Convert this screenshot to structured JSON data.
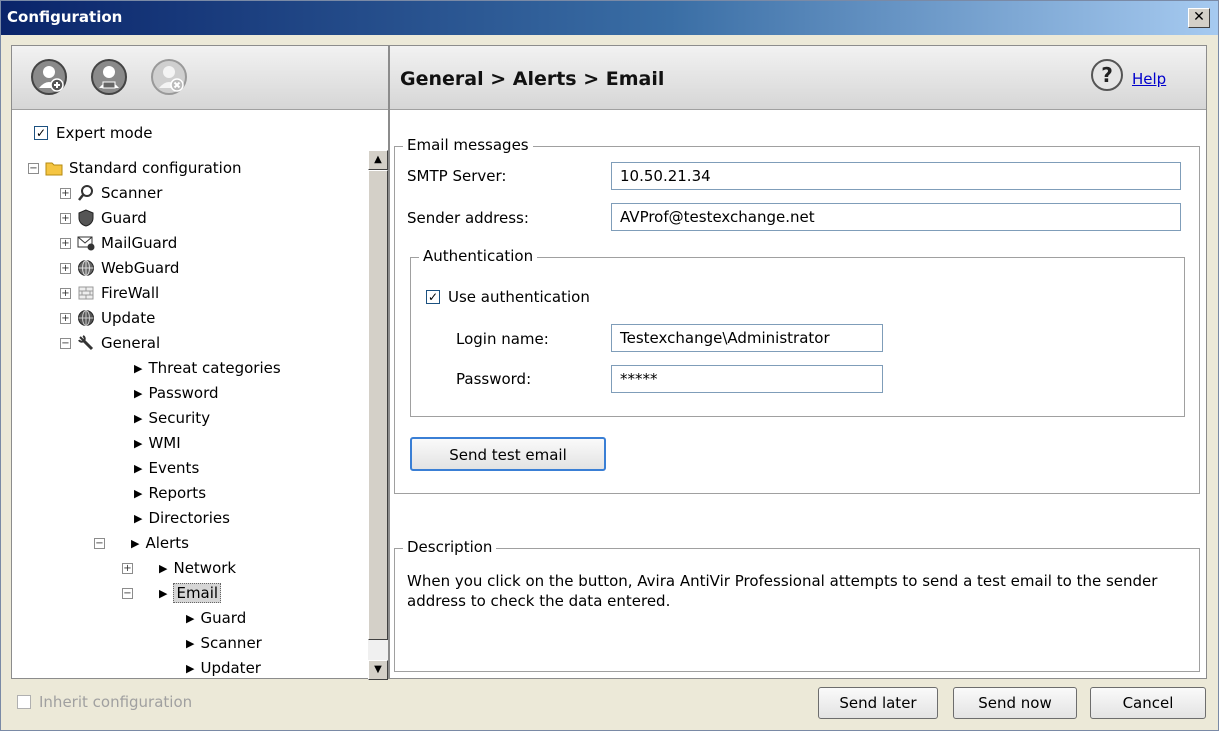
{
  "window": {
    "title": "Configuration",
    "close_glyph": "✕"
  },
  "left_header_icons": [
    "add-profile-icon",
    "profile-icon",
    "remove-profile-icon"
  ],
  "expert_mode": {
    "label": "Expert mode",
    "checked": true,
    "check_glyph": "✓"
  },
  "tree": {
    "root": "Standard configuration",
    "items": {
      "scanner": "Scanner",
      "guard": "Guard",
      "mailguard": "MailGuard",
      "webguard": "WebGuard",
      "firewall": "FireWall",
      "update": "Update",
      "general": "General",
      "threat_categories": "Threat categories",
      "password": "Password",
      "security": "Security",
      "wmi": "WMI",
      "events": "Events",
      "reports": "Reports",
      "directories": "Directories",
      "alerts": "Alerts",
      "network": "Network",
      "email": "Email",
      "email_guard": "Guard",
      "email_scanner": "Scanner",
      "email_updater": "Updater"
    },
    "plus": "+",
    "minus": "−",
    "arrow": "▶"
  },
  "header": {
    "breadcrumb": "General > Alerts > Email",
    "help_label": "Help"
  },
  "email_messages": {
    "legend": "Email messages",
    "smtp_label": "SMTP Server:",
    "smtp_value": "10.50.21.34",
    "sender_label": "Sender address:",
    "sender_value": "AVProf@testexchange.net"
  },
  "authentication": {
    "legend": "Authentication",
    "use_auth_label": "Use authentication",
    "use_auth_checked": true,
    "login_label": "Login name:",
    "login_value": "Testexchange\\Administrator",
    "password_label": "Password:",
    "password_value": "*****"
  },
  "send_test_button": "Send test email",
  "description": {
    "legend": "Description",
    "text": "When you click on the button, Avira AntiVir Professional attempts to send a test email to the sender address to check the data entered."
  },
  "footer": {
    "inherit_label": "Inherit configuration",
    "send_later": "Send later",
    "send_now": "Send now",
    "cancel": "Cancel"
  },
  "scrollbar": {
    "up": "▲",
    "down": "▼"
  }
}
